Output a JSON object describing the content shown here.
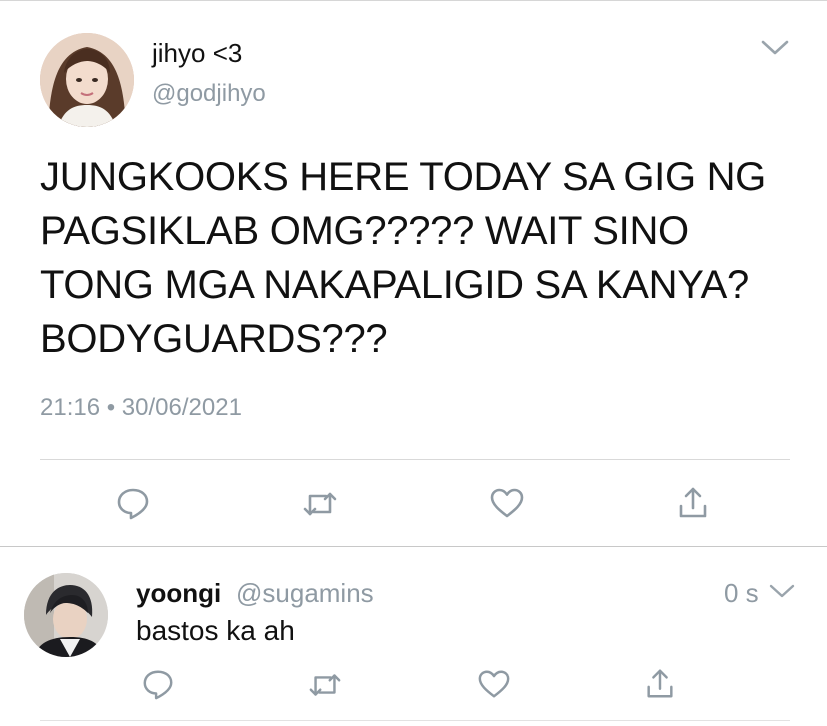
{
  "main_tweet": {
    "display_name": "jihyo <3",
    "handle": "@godjihyo",
    "text_lines": [
      "JUNGKOOKS HERE TODAY SA GIG NG",
      "PAGSIKLAB OMG????? WAIT SINO",
      "TONG MGA NAKAPALIGID SA KANYA?",
      "BODYGUARDS???"
    ],
    "timestamp": "21:16 • 30/06/2021",
    "actions": [
      "reply-icon",
      "retweet-icon",
      "like-icon",
      "share-icon"
    ]
  },
  "reply_tweet": {
    "display_name": "yoongi",
    "handle": "@sugamins",
    "time": "0 s",
    "text": "bastos ka ah",
    "actions": [
      "reply-icon",
      "retweet-icon",
      "like-icon",
      "share-icon"
    ]
  },
  "colors": {
    "text": "#111111",
    "secondary": "#8f9aa3",
    "icon": "#8f9aa3",
    "divider": "#d9d9d9"
  }
}
